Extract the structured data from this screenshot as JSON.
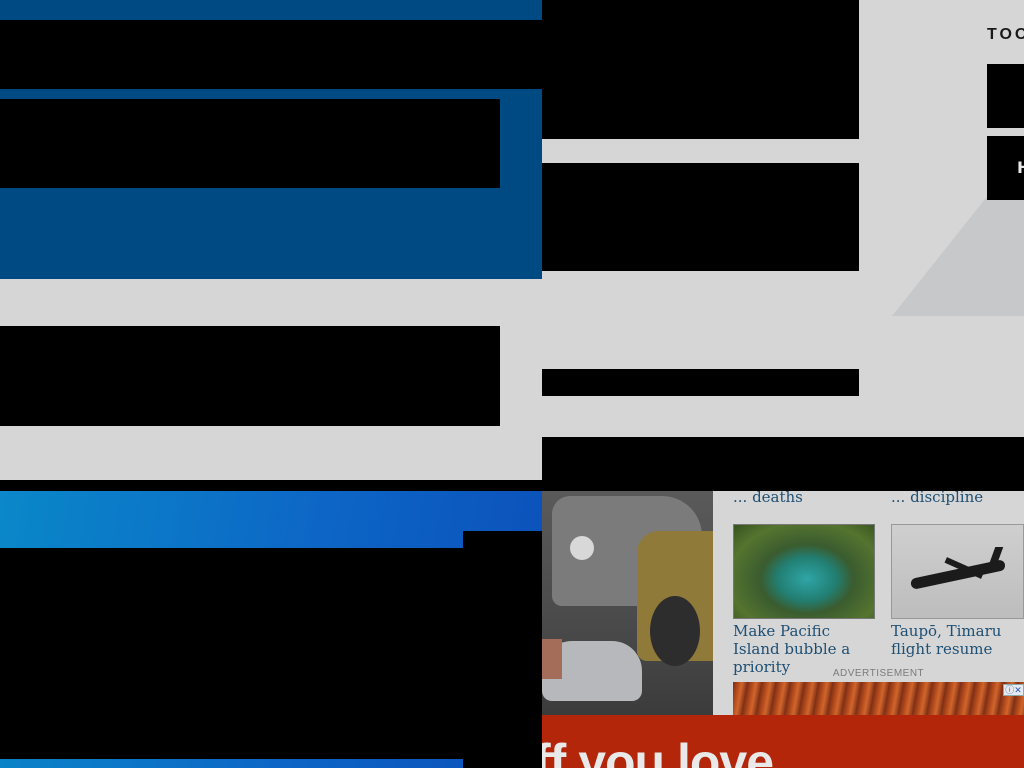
{
  "tools": {
    "title": "TOOL",
    "button_2_label": "H"
  },
  "stories": [
    {
      "title": "... deaths"
    },
    {
      "title": "... discipline"
    },
    {
      "title": "Make Pacific Island bubble a priority"
    },
    {
      "title": "Taupō, Timaru flight resume"
    }
  ],
  "ad": {
    "label": "ADVERTISEMENT",
    "choices_glyph": "ⓘ✕"
  },
  "promo": {
    "text": "ff you love"
  },
  "colors": {
    "brand_blue": "#004a84",
    "link_blue": "#1e4f74",
    "promo_red": "#b3260a"
  },
  "icons": {
    "ad_choices": "info-icon",
    "plane": "airplane-icon"
  }
}
